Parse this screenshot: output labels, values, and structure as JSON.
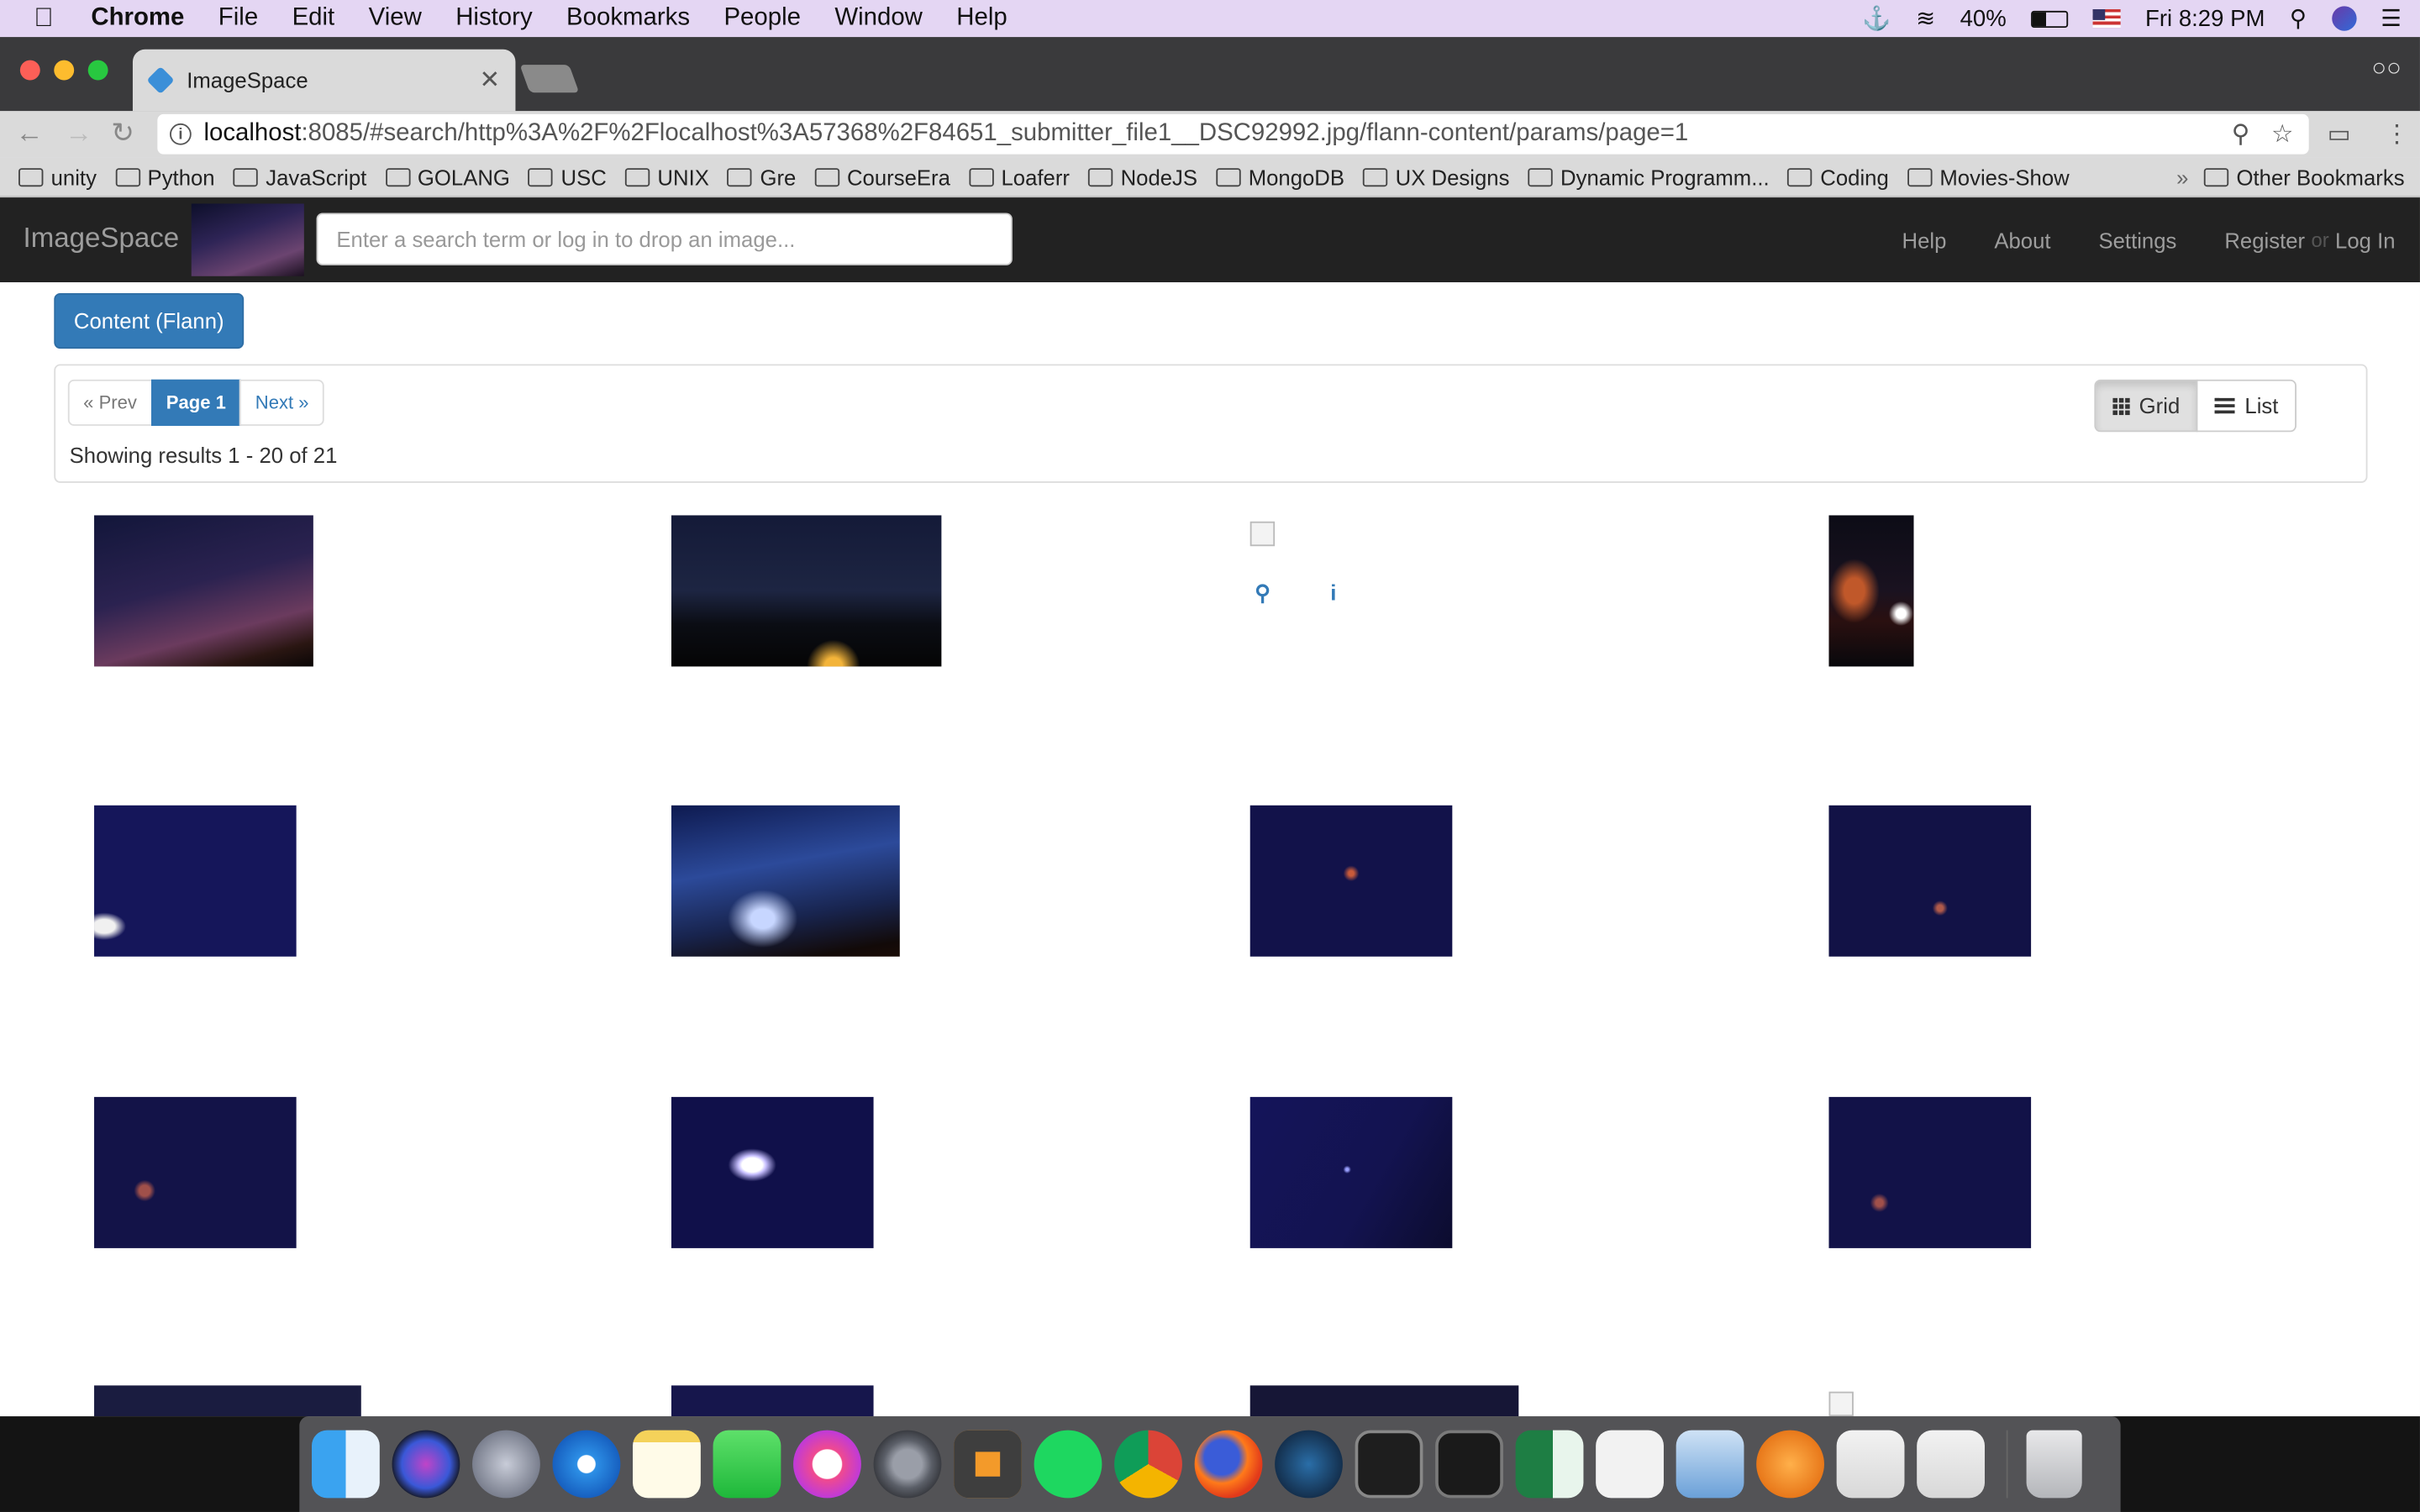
{
  "menubar": {
    "app": "Chrome",
    "items": [
      "File",
      "Edit",
      "View",
      "History",
      "Bookmarks",
      "People",
      "Window",
      "Help"
    ],
    "battery": "40%",
    "clock": "Fri 8:29 PM"
  },
  "browser": {
    "tab_title": "ImageSpace",
    "url_host": "localhost",
    "url_rest": ":8085/#search/http%3A%2F%2Flocalhost%3A57368%2F84651_submitter_file1__DSC92992.jpg/flann-content/params/page=1"
  },
  "bookmarks": [
    "unity",
    "Python",
    "JavaScript",
    "GOLANG",
    "USC",
    "UNIX",
    "Gre",
    "CourseEra",
    "Loaferr",
    "NodeJS",
    "MongoDB",
    "UX Designs",
    "Dynamic Programm...",
    "Coding",
    "Movies-Show"
  ],
  "bookmarks_more": "»",
  "bookmarks_other": "Other Bookmarks",
  "app": {
    "brand": "ImageSpace",
    "search_placeholder": "Enter a search term or log in to drop an image...",
    "nav": {
      "help": "Help",
      "about": "About",
      "settings": "Settings",
      "register": "Register",
      "or": "or",
      "login": "Log In"
    }
  },
  "content": {
    "flann_button": "Content (Flann)",
    "pager": {
      "prev": "« Prev",
      "current": "Page 1",
      "next": "Next »"
    },
    "results": "Showing results 1 - 20 of 21",
    "view": {
      "grid": "Grid",
      "list": "List"
    }
  },
  "colors": {
    "accent": "#337ab7",
    "navbar": "#222222"
  },
  "dock_apps": [
    "finder-icon",
    "siri-icon",
    "launchpad-icon",
    "safari-icon",
    "notes-icon",
    "facetime-icon",
    "itunes-icon",
    "system-preferences-icon",
    "sublime-text-icon",
    "spotify-icon",
    "chrome-icon",
    "firefox-icon",
    "steam-icon",
    "terminal-icon",
    "activity-monitor-icon",
    "excel-icon",
    "slack-icon",
    "preview-icon",
    "sketch-icon",
    "java-icon",
    "java-icon-2",
    "trash-icon"
  ]
}
